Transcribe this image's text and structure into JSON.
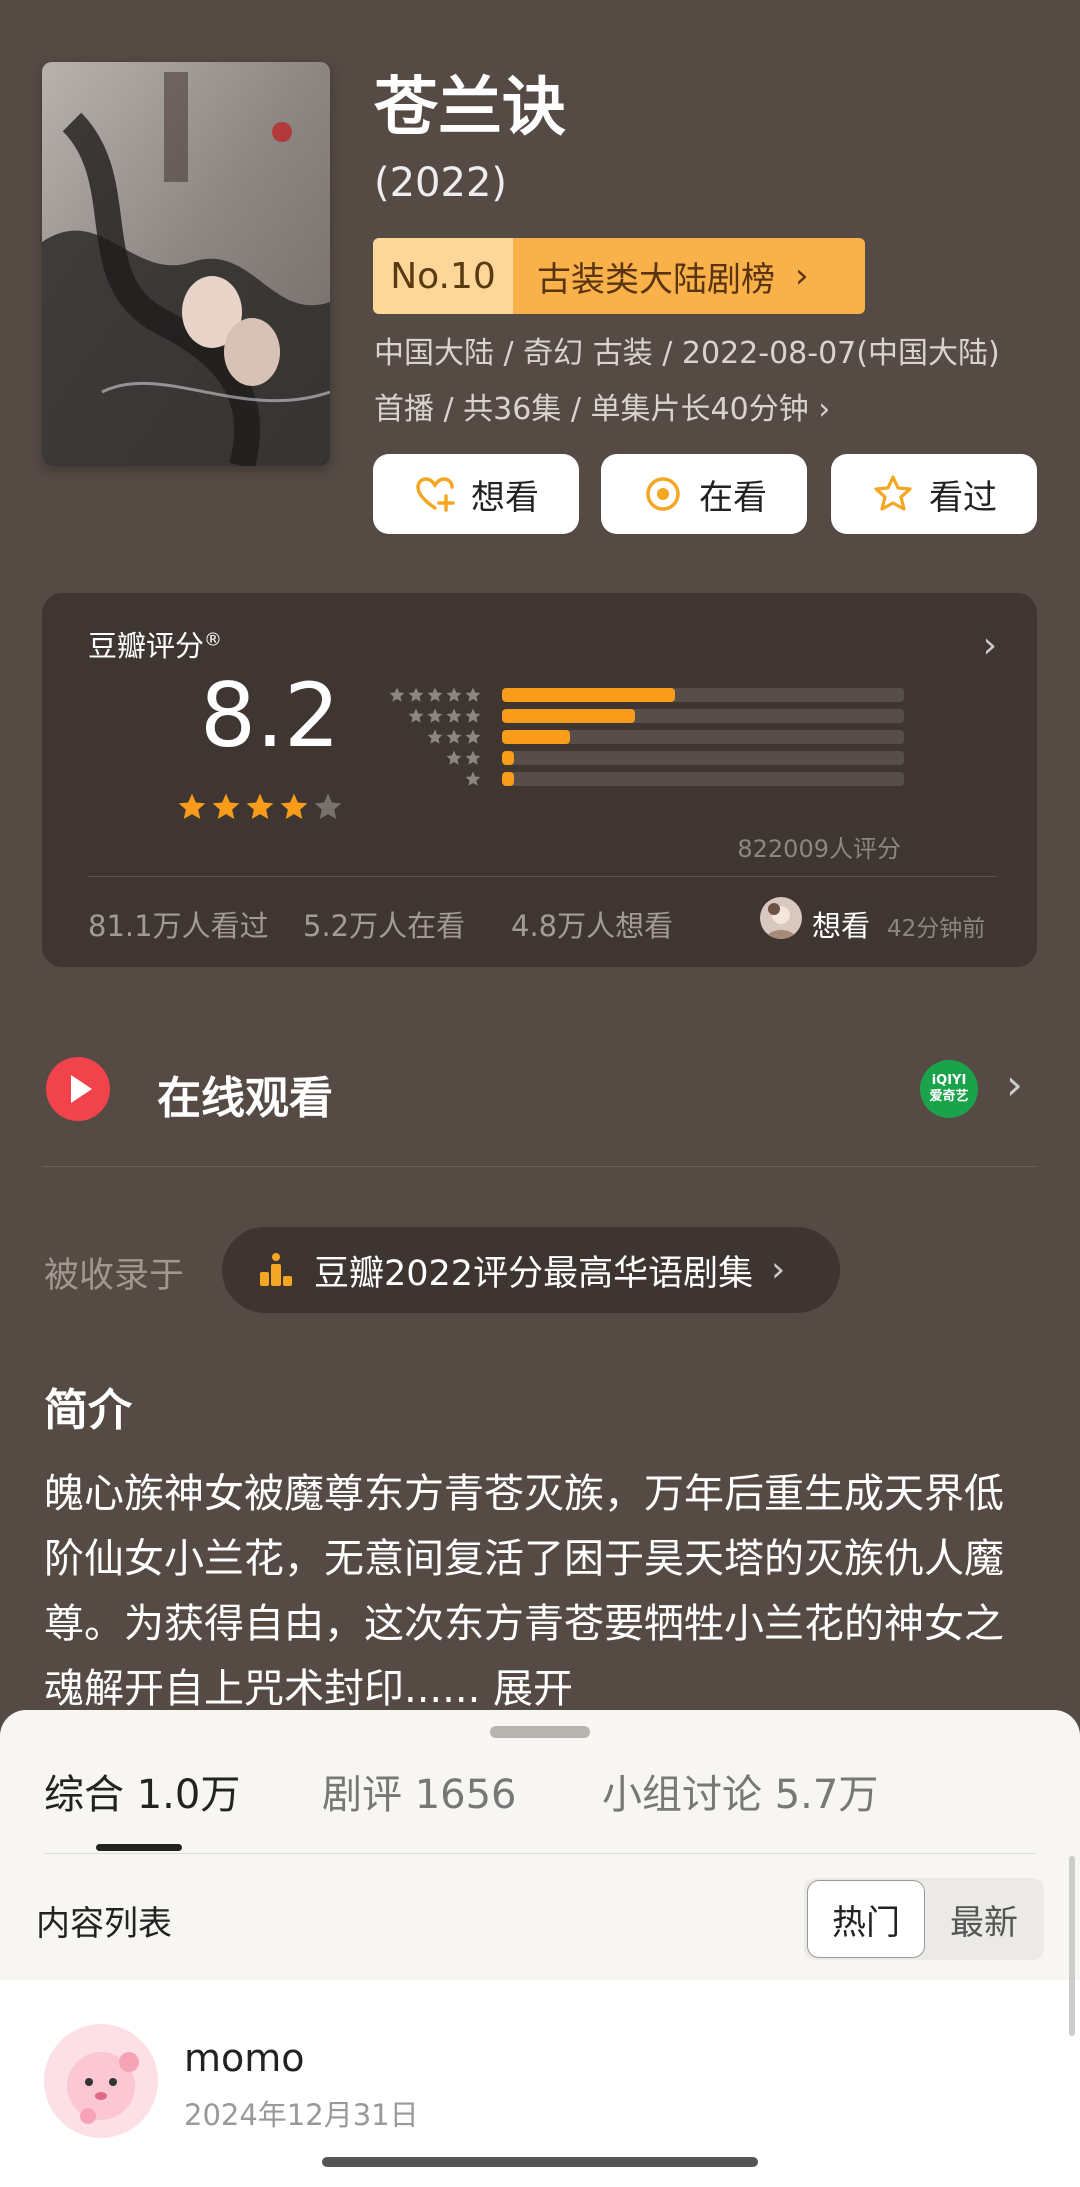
{
  "movie": {
    "title": "苍兰诀",
    "year": "(2022)",
    "rank_no": "No.10",
    "rank_list": "古装类大陆剧榜",
    "meta_line1": "中国大陆 / 奇幻 古装 / 2022-08-07(中国大陆)",
    "meta_line2": "首播 / 共36集 / 单集片长40分钟 ›"
  },
  "actions": {
    "want": "想看",
    "watching": "在看",
    "watched": "看过"
  },
  "rating": {
    "label": "豆瓣评分",
    "score": "8.2",
    "stars_filled": 4,
    "distribution_pct": [
      43,
      33,
      17,
      3,
      3
    ],
    "count_text": "822009人评分",
    "stat_watched": "81.1万人看过",
    "stat_watching": "5.2万人在看",
    "stat_want": "4.8万人想看",
    "recent_action": "想看",
    "recent_time": "42分钟前"
  },
  "watch": {
    "label": "在线观看",
    "provider_top": "iQIYI",
    "provider_bottom": "爱奇艺"
  },
  "included": {
    "label": "被收录于",
    "list": "豆瓣2022评分最高华语剧集"
  },
  "intro": {
    "heading": "简介",
    "body": "魄心族神女被魔尊东方青苍灭族，万年后重生成天界低阶仙女小兰花，无意间复活了困于昊天塔的灭族仇人魔尊。为获得自由，这次东方青苍要牺牲小兰花的神女之魂解开自上咒术封印...... 展开"
  },
  "sheet": {
    "tab_all": "综合 1.0万",
    "tab_reviews": "剧评 1656",
    "tab_groups": "小组讨论 5.7万",
    "list_label": "内容列表",
    "sort_hot": "热门",
    "sort_new": "最新",
    "post_user": "momo",
    "post_date": "2024年12月31日"
  },
  "colors": {
    "background": "#554a44",
    "accent_orange": "#f99c1a",
    "rank_light": "#fdd79a",
    "rank_dark": "#f9b24a",
    "play_red": "#f0434b",
    "iqiyi_green": "#1aa34a"
  }
}
